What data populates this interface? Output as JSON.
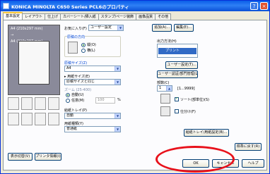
{
  "window": {
    "title": "KONICA MINOLTA C650 Series PCL6のプロパティ",
    "help_glyph": "?",
    "close_glyph": "×"
  },
  "tabs": [
    "基本設定",
    "レイアウト",
    "仕上げ",
    "カバーシート/挿入紙",
    "スタンプ/ページ装飾",
    "画像品質",
    "その他"
  ],
  "preview": {
    "lines": [
      "A4 (210x297 mm)",
      "→",
      "A4 (210x297 mm)"
    ]
  },
  "left_buttons": {
    "view": "表示切替(V)",
    "printer_info": "プリンタ情報(I)"
  },
  "favorites": {
    "label": "お気に入り(F)",
    "value": "ユーザー設定",
    "add": "追加(A)...",
    "edit": "編集(E)..."
  },
  "orientation": {
    "label": "原稿の方向",
    "options": [
      "縦(O)",
      "横(L)"
    ],
    "selected": "縦(O)"
  },
  "original_size": {
    "label": "原稿サイズ(Z)",
    "value": "A4"
  },
  "paper_size": {
    "label": "▸ 用紙サイズ(E)",
    "value": "原稿サイズと同じ"
  },
  "zoom": {
    "label": "ズーム (25-400)",
    "options": [
      "自動(U)",
      "任意(M)"
    ],
    "selected": "自動(U)",
    "value": "100",
    "unit": "%"
  },
  "paper_tray": {
    "label": "給紙トレイ(P)",
    "value": "自動"
  },
  "paper_type": {
    "label": "用紙種類(Y)",
    "value": "普通紙"
  },
  "output_method": {
    "label": "出力方法(H)",
    "selected": "プリント"
  },
  "user_settings_btn": "ユーザー設定(T)...",
  "auth_btn": "ユーザー認証/部門管理(L)...",
  "copies": {
    "label": "部数(C)",
    "value": "1",
    "range": "[1...9999]"
  },
  "collate": {
    "label": "ソート(部単位)(S)",
    "checked": true
  },
  "offset": {
    "label": "仕分け(F)",
    "checked": false
  },
  "paper_tray_settings_btn": "給紙トレイ/用紙設定(B)...",
  "restore_default_btn": "標準に戻す(R)",
  "dialog_buttons": {
    "ok": "OK",
    "cancel": "キャンセル",
    "help": "ヘルプ"
  }
}
